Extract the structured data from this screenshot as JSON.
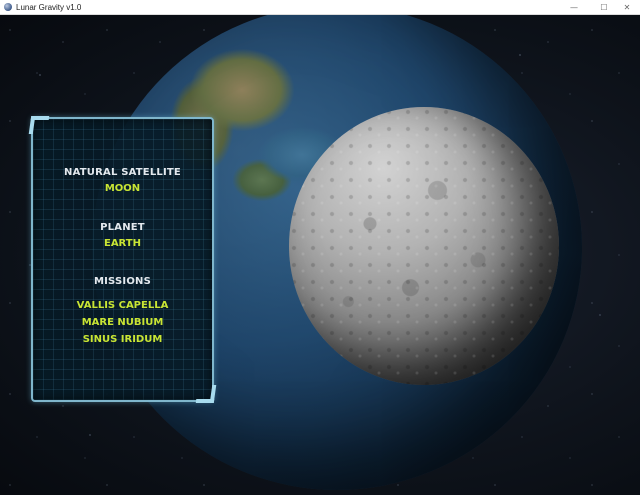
{
  "window": {
    "title": "Lunar Gravity v1.0",
    "controls": {
      "minimize": "—",
      "maximize": "☐",
      "close": "✕"
    }
  },
  "info_panel": {
    "satellite_label": "NATURAL SATELLITE",
    "satellite_value": "MOON",
    "planet_label": "PLANET",
    "planet_value": "EARTH",
    "missions_label": "MISSIONS",
    "missions": [
      "VALLIS CAPELLA",
      "MARE NUBIUM",
      "SINUS IRIDUM"
    ]
  },
  "colors": {
    "value_accent": "#c9e534",
    "label_text": "#e4e9ee",
    "panel_border": "#7fb6cc",
    "panel_fill": "#061a26"
  }
}
